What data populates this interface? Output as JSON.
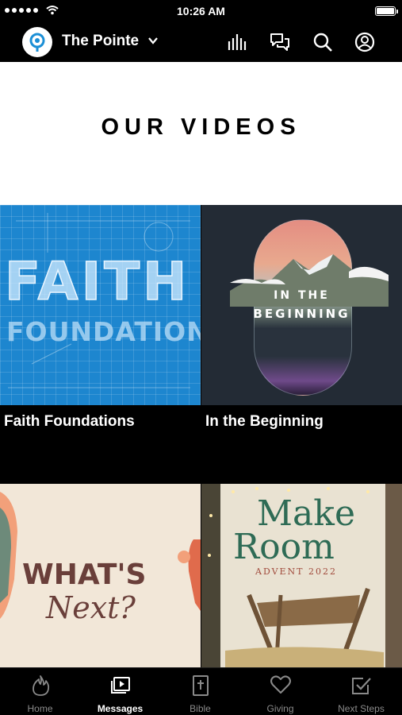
{
  "status_bar": {
    "time": "10:26 AM"
  },
  "header": {
    "church_name": "The Pointe"
  },
  "page": {
    "title": "OUR VIDEOS"
  },
  "videos": [
    {
      "label": "Faith Foundations",
      "art_line1": "FAITH",
      "art_line2": "FOUNDATIONS"
    },
    {
      "label": "In the Beginning",
      "art_line1": "IN THE",
      "art_line2": "BEGINNING"
    },
    {
      "label": "",
      "art_line1": "WHAT'S",
      "art_line2": "Next?"
    },
    {
      "label": "",
      "art_line1": "Make",
      "art_line2": "Room",
      "art_line3": "ADVENT 2022"
    }
  ],
  "tabs": [
    {
      "label": "Home",
      "icon": "flame-icon"
    },
    {
      "label": "Messages",
      "icon": "video-playlist-icon",
      "active": true
    },
    {
      "label": "Bible",
      "icon": "bible-icon"
    },
    {
      "label": "Giving",
      "icon": "heart-icon"
    },
    {
      "label": "Next Steps",
      "icon": "checkbox-icon"
    }
  ]
}
